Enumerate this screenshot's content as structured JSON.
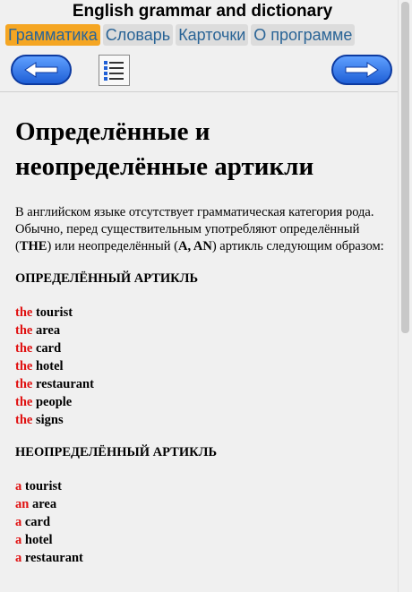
{
  "app": {
    "title": "English grammar and dictionary"
  },
  "tabs": [
    {
      "label": "Грамматика",
      "active": true
    },
    {
      "label": "Словарь",
      "active": false
    },
    {
      "label": "Карточки",
      "active": false
    },
    {
      "label": "О программе",
      "active": false
    }
  ],
  "toolbar": {
    "back_icon": "arrow-left-icon",
    "toc_icon": "list-icon",
    "next_icon": "arrow-right-icon"
  },
  "colors": {
    "active_tab": "#f5a623",
    "tab_text": "#2a6496",
    "nav_button": "#1f5fd6",
    "article_red": "#e01010"
  },
  "article": {
    "title": "Определённые и неопределённые артикли",
    "intro_parts": [
      "В английском языке отсутствует грамматическая категория рода.  Обычно, перед существительным употребляют определённый (",
      "THE",
      ") или неопределённый (",
      "A, AN",
      ") артикль следующим образом:"
    ],
    "definite": {
      "heading": "ОПРЕДЕЛЁННЫЙ АРТИКЛЬ",
      "examples": [
        {
          "article": "the",
          "noun": " tourist"
        },
        {
          "article": "the",
          "noun": " area"
        },
        {
          "article": "the",
          "noun": " card"
        },
        {
          "article": "the",
          "noun": " hotel"
        },
        {
          "article": "the",
          "noun": " restaurant"
        },
        {
          "article": "the",
          "noun": " people"
        },
        {
          "article": "the",
          "noun": " signs"
        }
      ]
    },
    "indefinite": {
      "heading": "НЕОПРЕДЕЛЁННЫЙ АРТИКЛЬ",
      "examples": [
        {
          "article": "a",
          "noun": " tourist"
        },
        {
          "article": "an",
          "noun": " area"
        },
        {
          "article": "a",
          "noun": " card"
        },
        {
          "article": "a",
          "noun": " hotel"
        },
        {
          "article": "a",
          "noun": " restaurant"
        }
      ]
    }
  }
}
